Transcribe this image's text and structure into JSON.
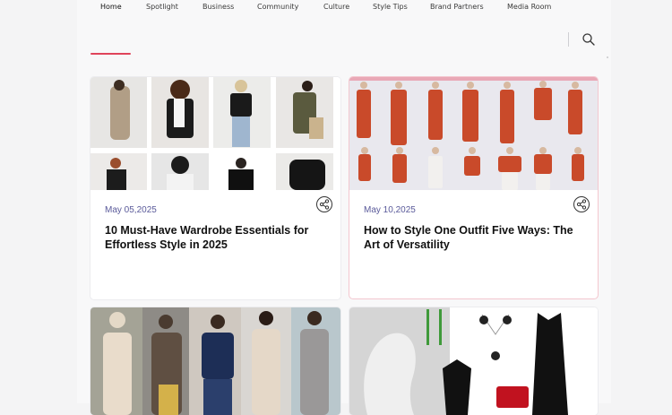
{
  "nav": {
    "items": [
      {
        "label": "Home"
      },
      {
        "label": "Spotlight"
      },
      {
        "label": "Business"
      },
      {
        "label": "Community"
      },
      {
        "label": "Culture"
      },
      {
        "label": "Style Tips"
      },
      {
        "label": "Brand Partners"
      },
      {
        "label": "Media Room"
      }
    ],
    "active": "Home",
    "search_icon": "search-icon"
  },
  "cards": [
    {
      "date": "May 05,2025",
      "title": "10 Must-Have Wardrobe Essentials for Effortless Style in 2025",
      "share_icon": "share-icon"
    },
    {
      "date": "May 10,2025",
      "title": "How to Style One Outfit Five Ways: The Art of Versatility",
      "share_icon": "share-icon"
    },
    {
      "date": "",
      "title": "",
      "share_icon": ""
    },
    {
      "date": "",
      "title": "",
      "share_icon": ""
    }
  ],
  "colors": {
    "accent": "#e0445a",
    "date": "#5a5a9a",
    "card_bg": "#ffffff",
    "page_bg": "#f4f4f5"
  }
}
